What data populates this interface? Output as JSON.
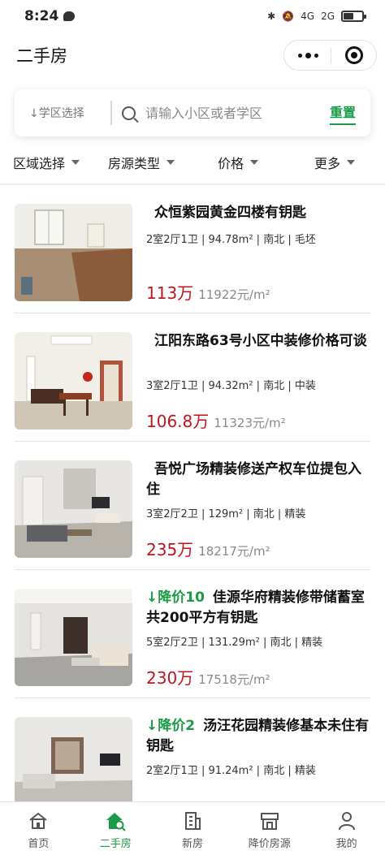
{
  "status_bar": {
    "time": "8:24",
    "network_1": "4G",
    "network_2": "2G",
    "battery_level": 0.55
  },
  "nav": {
    "title": "二手房"
  },
  "search": {
    "school_select_label": "↓学区选择",
    "placeholder": "请输入小区或者学区",
    "reset_label": "重置"
  },
  "filters": [
    {
      "label": "区域选择"
    },
    {
      "label": "房源类型"
    },
    {
      "label": "价格"
    },
    {
      "label": "更多"
    }
  ],
  "listings": [
    {
      "price_drop": "",
      "title": "众恒紫园黄金四楼有钥匙",
      "specs": "2室2厅1卫 | 94.78m² | 南北 | 毛坯",
      "price": "113万",
      "unit_price": "11922元/m²"
    },
    {
      "price_drop": "",
      "title": "江阳东路63号小区中装修价格可谈",
      "specs": "3室2厅1卫 | 94.32m² | 南北 | 中装",
      "price": "106.8万",
      "unit_price": "11323元/m²"
    },
    {
      "price_drop": "",
      "title": "吾悦广场精装修送产权车位提包入住",
      "specs": "3室2厅2卫 | 129m² | 南北 | 精装",
      "price": "235万",
      "unit_price": "18217元/m²"
    },
    {
      "price_drop": "↓降价10",
      "title": "佳源华府精装修带储蓄室共200平方有钥匙",
      "specs": "5室2厅2卫 | 131.29m² | 南北 | 精装",
      "price": "230万",
      "unit_price": "17518元/m²"
    },
    {
      "price_drop": "↓降价2",
      "title": "汤汪花园精装修基本未住有钥匙",
      "specs": "2室2厅1卫 | 91.24m² | 南北 | 精装",
      "price": "",
      "unit_price": ""
    }
  ],
  "tabs": [
    {
      "label": "首页",
      "icon": "home-icon"
    },
    {
      "label": "二手房",
      "icon": "house-search-icon"
    },
    {
      "label": "新房",
      "icon": "building-icon"
    },
    {
      "label": "降价房源",
      "icon": "shop-icon"
    },
    {
      "label": "我的",
      "icon": "user-icon"
    }
  ],
  "colors": {
    "accent": "#1a9b46",
    "price": "#c0141c"
  }
}
